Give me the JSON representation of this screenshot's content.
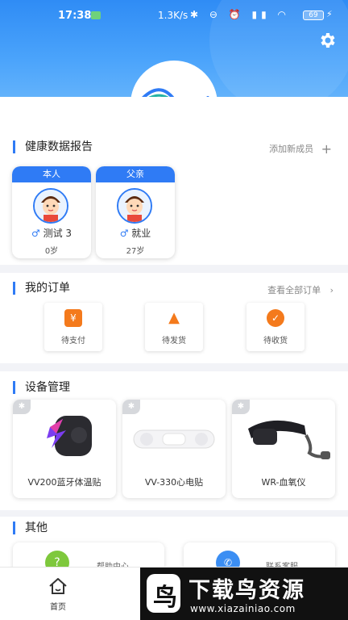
{
  "status_bar": {
    "time": "17:38",
    "network_speed": "1.3K/s",
    "battery": "69"
  },
  "colors": {
    "accent": "#2f7bf5",
    "orange": "#f47a1c",
    "green": "#7ec83c"
  },
  "health": {
    "title": "健康数据报告",
    "add_member": "添加新成员",
    "add_icon": "plus-icon",
    "members": [
      {
        "relation": "本人",
        "name": "测试 3",
        "age": "0岁"
      },
      {
        "relation": "父亲",
        "name": "就业",
        "age": "27岁"
      }
    ]
  },
  "orders": {
    "title": "我的订单",
    "view_all": "查看全部订单",
    "items": [
      {
        "label": "待支付",
        "icon": "yen-icon",
        "glyph": "¥"
      },
      {
        "label": "待发货",
        "icon": "ship-icon",
        "glyph": "▲"
      },
      {
        "label": "待收货",
        "icon": "check-icon",
        "glyph": "✓"
      }
    ]
  },
  "devices": {
    "title": "设备管理",
    "items": [
      {
        "label": "VV200蓝牙体温贴"
      },
      {
        "label": "VV-330心电贴"
      },
      {
        "label": "WR-血氧仪"
      }
    ]
  },
  "others": {
    "title": "其他",
    "items": [
      {
        "label": "帮助中心"
      },
      {
        "label": "联系客服"
      }
    ]
  },
  "tabbar": {
    "home": "首页"
  },
  "watermark": {
    "big": "下载鸟资源",
    "small": "www.xiazainiao.com",
    "logo_glyph": "鸟"
  }
}
